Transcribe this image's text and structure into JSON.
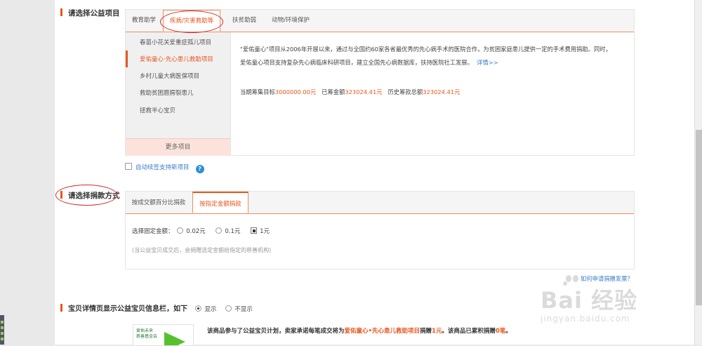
{
  "section1": {
    "title": "请选择公益项目"
  },
  "category_tabs": [
    {
      "label": "教育助学",
      "active": false
    },
    {
      "label": "疾病/灾害救助等",
      "active": true
    },
    {
      "label": "扶贫助弱",
      "active": false
    },
    {
      "label": "动物/环境保护",
      "active": false
    }
  ],
  "projects": [
    {
      "label": "春苗小花关爱重症孤儿项目",
      "active": false
    },
    {
      "label": "爱佑童心·先心患儿救助项目",
      "active": true
    },
    {
      "label": "乡村儿童大病医保项目",
      "active": false
    },
    {
      "label": "救助贫困唇腭裂患儿",
      "active": false
    },
    {
      "label": "拯救半心宝贝",
      "active": false
    }
  ],
  "more_projects": "更多项目",
  "description": {
    "line1": "\"爱佑童心\"项目从2006年开展以来，通过与全国约60家各省最优秀的先心病手术的医院合作，为贫困家庭患儿提供一定的手术费用捐助。同时，",
    "line2": "爱佑童心项目支持复杂先心病临床科研项目，建立全国先心病数据库，扶持医院社工发展。",
    "details_link": "详情>>"
  },
  "stats": {
    "target_label": "当期筹集目标",
    "target_value": "3000000.00元",
    "raised_label": "已筹金额",
    "raised_value": "323024.41元",
    "total_label": "历史筹款总额",
    "total_value": "323024.41元"
  },
  "auto_renew": {
    "label": "自动续签支持新项目",
    "checked": false,
    "help_icon": "?"
  },
  "section2": {
    "title": "请选择捐款方式"
  },
  "donation_tabs": [
    {
      "label": "按成交额百分比捐款",
      "active": false
    },
    {
      "label": "按指定金额捐款",
      "active": true
    }
  ],
  "fixed_amount": {
    "label": "选择固定金额：",
    "options": [
      {
        "label": "0.02元",
        "selected": false
      },
      {
        "label": "0.1元",
        "selected": false
      },
      {
        "label": "1元",
        "selected": true
      }
    ],
    "note": "(当公益宝贝成交后，会捐赠选定金额给指定的慈善机构)"
  },
  "invoice_link": "如何申请捐赠发票？",
  "section3": {
    "title": "宝贝详情页显示公益宝贝信息栏，如下",
    "options": [
      {
        "label": "显示",
        "selected": true
      },
      {
        "label": "不显示",
        "selected": false
      }
    ]
  },
  "promo": {
    "image_text": "爱佑未来 慈善基金会",
    "text_prefix": "该商品参与了公益宝贝计划，卖家承诺每笔成交将为",
    "project_name": "爱佑童心•先心患儿救助项目",
    "text_mid": "捐赠",
    "amount": "1元",
    "text_suffix": "。该商品已累积捐赠",
    "count": "0笔",
    "text_end": "。"
  },
  "watermark": {
    "brand": "Bai 经验",
    "url": "jingyan.baidu.com"
  },
  "colors": {
    "accent": "#e8561d",
    "link": "#3a7ac9",
    "annotation": "#c8302b"
  }
}
